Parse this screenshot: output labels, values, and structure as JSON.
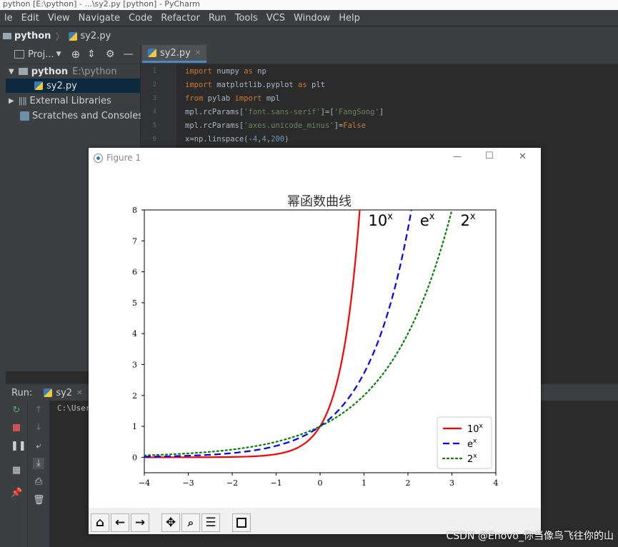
{
  "window": {
    "title": "python [E:\\python] - ...\\sy2.py [python] - PyCharm"
  },
  "menu": {
    "items": [
      "le",
      "Edit",
      "View",
      "Navigate",
      "Code",
      "Refactor",
      "Run",
      "Tools",
      "VCS",
      "Window",
      "Help"
    ]
  },
  "breadcrumb": {
    "project": "python",
    "file": "sy2.py"
  },
  "project_panel": {
    "header_label": "Proj...",
    "root_label": "python",
    "root_path": "E:\\python",
    "file_label": "sy2.py",
    "external_label": "External Libraries",
    "scratches_label": "Scratches and Consoles"
  },
  "editor": {
    "tab_label": "sy2.py",
    "line_numbers": [
      "1",
      "2",
      "3",
      "4",
      "5",
      "6"
    ]
  },
  "run_panel": {
    "title": "Run:",
    "tab_label": "sy2",
    "output_text": "C:\\User"
  },
  "figure": {
    "window_title": "Figure 1",
    "minimize_glyph": "—",
    "maximize_glyph": "☐",
    "close_glyph": "✕"
  },
  "chart_data": {
    "type": "line",
    "title": "幂函数曲线",
    "xlim": [
      -4,
      4
    ],
    "ylim": [
      -0.5,
      8
    ],
    "xticks": [
      "−4",
      "−3",
      "−2",
      "−1",
      "0",
      "1",
      "2",
      "3",
      "4"
    ],
    "yticks": [
      "0",
      "1",
      "2",
      "3",
      "4",
      "5",
      "6",
      "7",
      "8"
    ],
    "x_range": {
      "start": -4,
      "stop": 4,
      "num": 200
    },
    "series": [
      {
        "name": "10^x",
        "base": 10,
        "color": "#ff0000",
        "style": "solid",
        "annotation": "10^x"
      },
      {
        "name": "e^x",
        "base": 2.718281828,
        "color": "#0000ff",
        "style": "dashed",
        "annotation": "e^x"
      },
      {
        "name": "2^x",
        "base": 2,
        "color": "#008000",
        "style": "dotted",
        "annotation": "2^x"
      }
    ],
    "legend_position": "lower-right",
    "grid": false
  },
  "watermark": "CSDN @Enovo_你当像鸟飞往你的山"
}
